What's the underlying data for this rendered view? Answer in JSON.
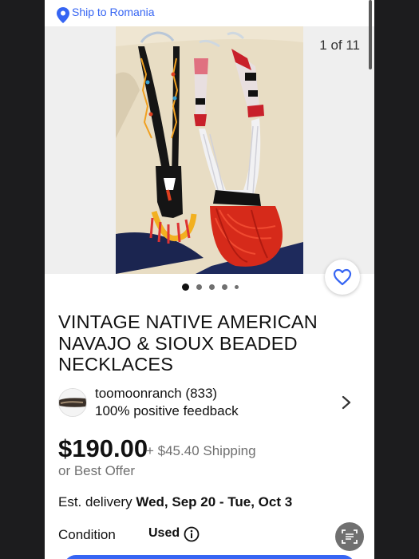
{
  "shipping_banner": {
    "text": "Ship to Romania",
    "icon": "location-pin-icon"
  },
  "gallery": {
    "counter": "1 of 11",
    "page_count_dots": 5,
    "active_dot": 1
  },
  "listing": {
    "title": "VINTAGE NATIVE AMERICAN NAVAJO & SIOUX BEADED NECKLACES",
    "seller": {
      "name_and_count": "toomoonranch (833)",
      "feedback": "100% positive feedback"
    },
    "price": "$190.00",
    "shipping": "+ $45.40 Shipping",
    "offer": "or Best Offer",
    "delivery": {
      "prefix": "Est. delivery",
      "range": "Wed, Sep 20 - Tue, Oct 3"
    },
    "condition": {
      "label": "Condition",
      "value": "Used"
    }
  },
  "colors": {
    "accent": "#3665f3",
    "text": "#111111",
    "muted": "#707070"
  }
}
